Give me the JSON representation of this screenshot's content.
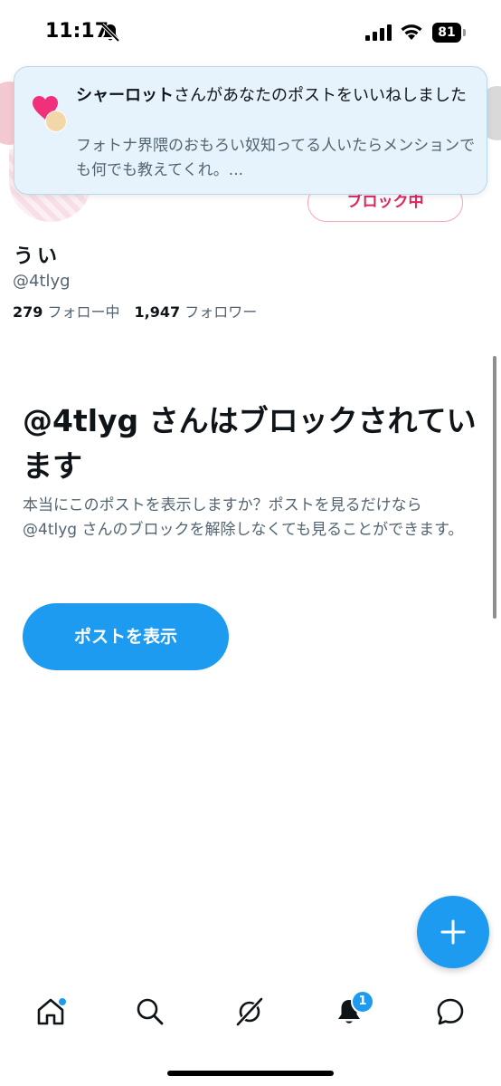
{
  "status_bar": {
    "time": "11:17",
    "battery": "81"
  },
  "notification": {
    "sender": "シャーロット",
    "action": "さんがあなたのポストをいいねしました",
    "body": "フォトナ界隈のおもろい奴知ってる人いたらメンションでも何でも教えてくれ。..."
  },
  "profile": {
    "blocked_label": "ブロック中",
    "display_name": "うい",
    "handle": "@4tlyg",
    "following_count": "279",
    "following_label": "フォロー中",
    "followers_count": "1,947",
    "followers_label": "フォロワー"
  },
  "blocked_notice": {
    "heading": "@4tlyg さんはブロックされています",
    "description": "本当にこのポストを表示しますか？ポストを見るだけなら @4tlyg さんのブロックを解除しなくても見ることができます。",
    "button_label": "ポストを表示"
  },
  "bottom_nav": {
    "items": [
      {
        "icon": "home-icon",
        "has_dot": true
      },
      {
        "icon": "search-icon"
      },
      {
        "icon": "grok-icon"
      },
      {
        "icon": "bell-icon",
        "badge": "1"
      },
      {
        "icon": "messages-icon"
      }
    ]
  },
  "colors": {
    "accent": "#1d9bf0",
    "blocked": "#e0245e",
    "banner_bg": "#e7f3fc",
    "secondary_text": "#536471"
  }
}
